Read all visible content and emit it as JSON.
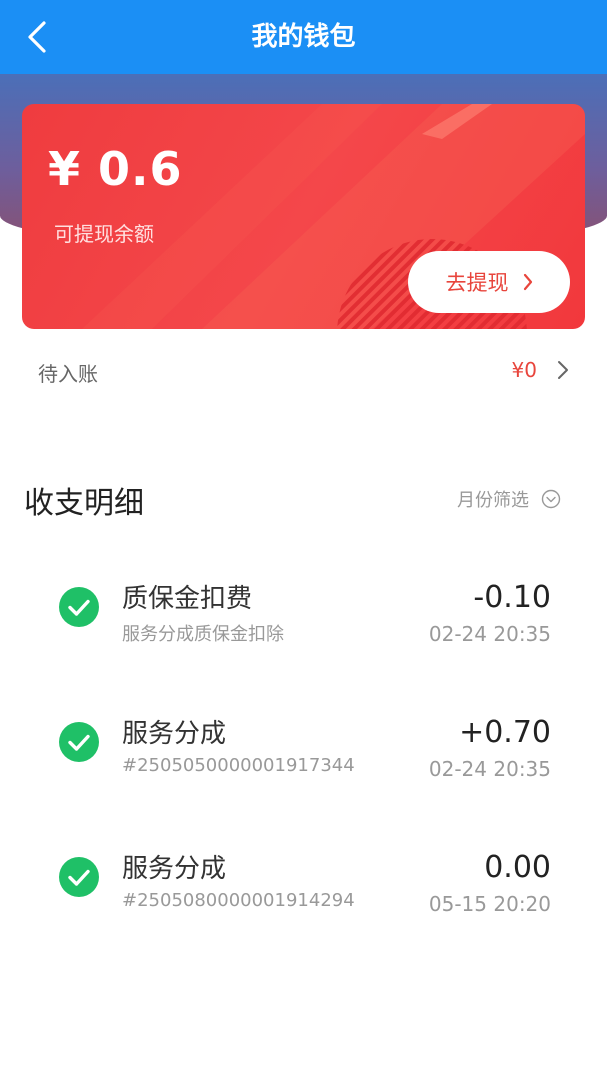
{
  "header": {
    "title": "我的钱包",
    "back_icon": "chevron-left-icon"
  },
  "colors": {
    "header_bg": "#1b8ff5",
    "card_red": "#f2383c",
    "accent_red": "#e8453c",
    "success_green": "#1fc067"
  },
  "balance_card": {
    "amount": "¥ 0.6",
    "label": "可提现余额",
    "withdraw_label": "去提现"
  },
  "pending": {
    "label": "待入账",
    "value": "¥0"
  },
  "details": {
    "title": "收支明细",
    "filter_label": "月份筛选"
  },
  "transactions": [
    {
      "title": "质保金扣费",
      "subtitle": "服务分成质保金扣除",
      "amount": "-0.10",
      "time": "02-24 20:35",
      "icon": "check-circle-icon"
    },
    {
      "title": "服务分成",
      "subtitle": "#2505050000001917344",
      "amount": "+0.70",
      "time": "02-24 20:35",
      "icon": "check-circle-icon"
    },
    {
      "title": "服务分成",
      "subtitle": "#2505080000001914294",
      "amount": "0.00",
      "time": "05-15 20:20",
      "icon": "check-circle-icon"
    }
  ]
}
